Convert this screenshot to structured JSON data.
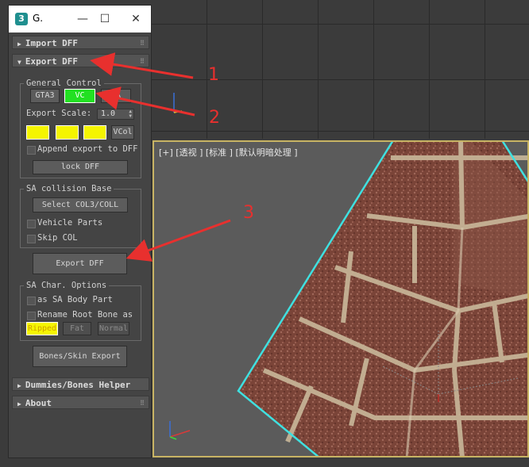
{
  "viewport": {
    "label": "[+] [透视 ] [标准 ] [默认明暗处理 ]"
  },
  "window": {
    "title": "G.",
    "icon": "3",
    "minimize": "—",
    "maximize": "☐",
    "close": "✕"
  },
  "rollouts": {
    "import": "Import DFF",
    "export": "Export DFF",
    "dummies": "Dummies/Bones Helper",
    "about": "About"
  },
  "general_control": {
    "title": "General Control",
    "buttons": [
      "GTA3",
      "VC",
      "SA"
    ],
    "scale_label": "Export Scale:",
    "scale_value": "1.0",
    "vcol_label": "VCol",
    "append_label": "Append export to DFF",
    "lock_label": "lock DFF"
  },
  "sa_collision": {
    "title": "SA collision Base",
    "select_label": "Select COL3/COLL",
    "vehicle_parts": "Vehicle Parts",
    "skip_col": "Skip COL"
  },
  "export_button": "Export DFF",
  "sa_char": {
    "title": "SA Char. Options",
    "body_part": "as SA Body Part",
    "rename_root": "Rename Root Bone as",
    "modes": [
      "Ripped",
      "Fat",
      "Normal"
    ]
  },
  "bones_export": "Bones/Skin Export",
  "annotations": [
    "1",
    "2",
    "3"
  ],
  "colors": {
    "annotation": "#e8302e",
    "active_green": "#22e022",
    "yellow": "#f5f500",
    "selection": "#3fe0e0"
  }
}
